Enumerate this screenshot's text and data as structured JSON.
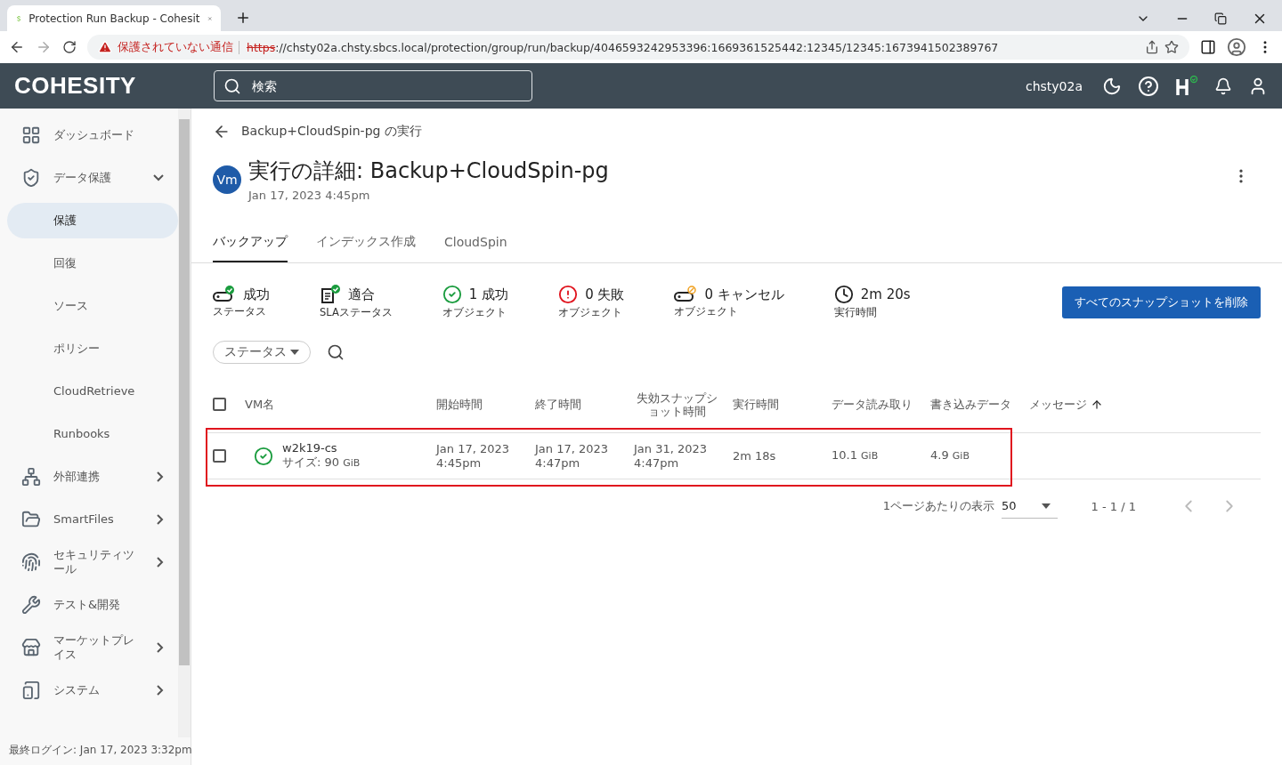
{
  "browser": {
    "tab_title": "Protection Run Backup - Cohesit",
    "warning": "保護されていない通信",
    "url_scheme": "https",
    "url_rest": "://chsty02a.chsty.sbcs.local/protection/group/run/backup/4046593242953396:1669361525442:12345/12345:1673941502389767"
  },
  "header": {
    "logo": "COHESITY",
    "search_placeholder": "検索",
    "cluster": "chsty02a"
  },
  "sidebar": {
    "items": [
      {
        "label": "ダッシュボード",
        "kind": "item",
        "selected": false
      },
      {
        "label": "データ保護",
        "kind": "group",
        "expanded": true,
        "children": [
          {
            "label": "保護",
            "selected": true
          },
          {
            "label": "回復",
            "selected": false
          },
          {
            "label": "ソース",
            "selected": false
          },
          {
            "label": "ポリシー",
            "selected": false
          },
          {
            "label": "CloudRetrieve",
            "selected": false
          },
          {
            "label": "Runbooks",
            "selected": false
          }
        ]
      },
      {
        "label": "外部連携",
        "kind": "group",
        "expanded": false
      },
      {
        "label": "SmartFiles",
        "kind": "group",
        "expanded": false
      },
      {
        "label": "セキュリティツール",
        "kind": "group",
        "expanded": false
      },
      {
        "label": "テスト&開発",
        "kind": "item",
        "selected": false
      },
      {
        "label": "マーケットプレイス",
        "kind": "group",
        "expanded": false
      },
      {
        "label": "システム",
        "kind": "group",
        "expanded": false
      }
    ],
    "last_login": "最終ログイン: Jan 17, 2023 3:32pm"
  },
  "page": {
    "back_link": "Backup+CloudSpin-pg の実行",
    "avatar": "Vm",
    "title": "実行の詳細: Backup+CloudSpin-pg",
    "subtitle": "Jan 17, 2023 4:45pm",
    "tabs": [
      {
        "label": "バックアップ",
        "selected": true
      },
      {
        "label": "インデックス作成",
        "selected": false
      },
      {
        "label": "CloudSpin",
        "selected": false
      }
    ],
    "stats": [
      {
        "kind": "run-ok",
        "value": "成功",
        "label": "ステータス"
      },
      {
        "kind": "sla-ok",
        "value": "適合",
        "label": "SLAステータス"
      },
      {
        "kind": "success",
        "value": "1 成功",
        "label": "オブジェクト"
      },
      {
        "kind": "failed",
        "value": "0 失敗",
        "label": "オブジェクト"
      },
      {
        "kind": "cancelled",
        "value": "0 キャンセル",
        "label": "オブジェクト"
      },
      {
        "kind": "duration",
        "value": "2m 20s",
        "label": "実行時間"
      }
    ],
    "delete_button": "すべてのスナップショットを削除",
    "filter": "ステータス",
    "table": {
      "select_all_checked": false,
      "columns": [
        "VM名",
        "開始時間",
        "終了時間",
        "失効スナップショット時間",
        "実行時間",
        "データ読み取り",
        "書き込みデータ",
        "メッセージ"
      ],
      "rows": [
        {
          "checked": false,
          "highlighted": true,
          "name": "w2k19-cs",
          "size_label": "サイズ: 90",
          "size_unit": "GiB",
          "start": [
            "Jan 17, 2023",
            "4:45pm"
          ],
          "end": [
            "Jan 17, 2023",
            "4:47pm"
          ],
          "expiry": [
            "Jan 31, 2023",
            "4:47pm"
          ],
          "duration": "2m 18s",
          "read": "10.1",
          "read_unit": "GiB",
          "written": "4.9",
          "written_unit": "GiB"
        }
      ]
    },
    "pagination": {
      "label": "1ページあたりの表示",
      "per_page": "50",
      "range": "1 - 1 / 1"
    }
  }
}
